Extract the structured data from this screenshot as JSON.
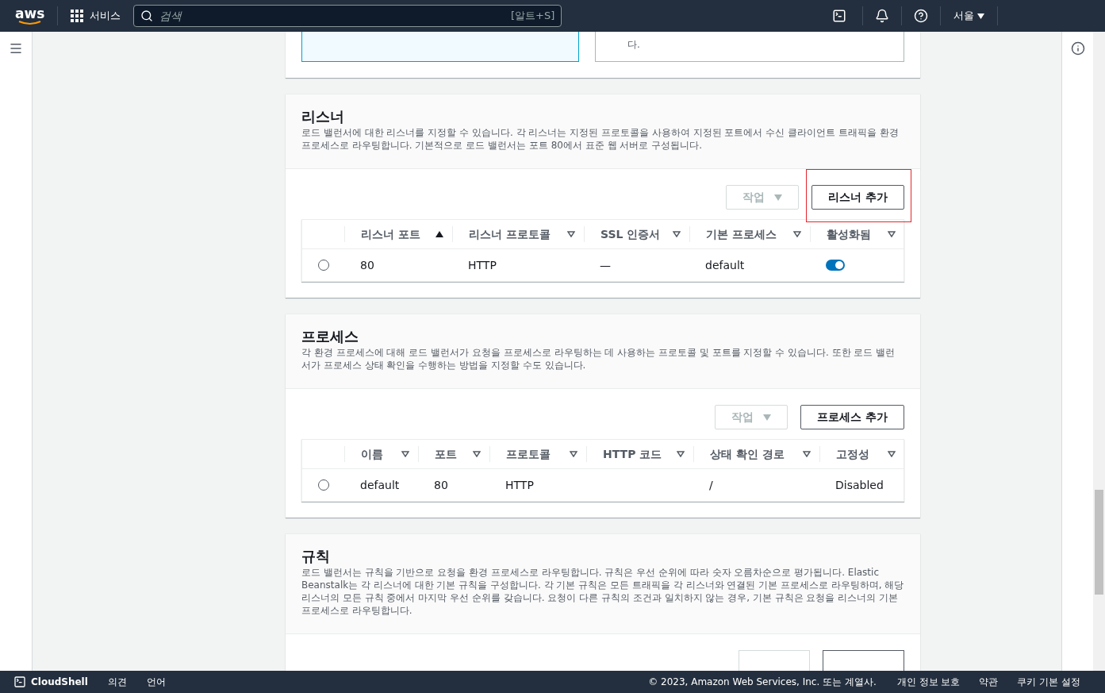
{
  "header": {
    "logo": "aws",
    "services": "서비스",
    "search": {
      "placeholder": "검색",
      "shortcut": "[알트+S]"
    },
    "region": "서울"
  },
  "top_card": {
    "right_text": "다."
  },
  "sections": [
    {
      "kind": "table",
      "title": "리스너",
      "description": "로드 밸런서에 대한 리스너를 지정할 수 있습니다. 각 리스너는 지정된 프로토콜을 사용하여 지정된 포트에서 수신 클라이언트 트래픽을 환경 프로세스로 라우팅합니다. 기본적으로 로드 밸런서는 포트 80에서 표준 웹 서버로 구성됩니다.",
      "highlight_add": true,
      "actions": [
        {
          "label": "작업",
          "disabled": true
        },
        {
          "label": "리스너 추가",
          "disabled": false
        }
      ],
      "columns": [
        {
          "label": "리스너 포트",
          "sorted": true
        },
        {
          "label": "리스너 프로토콜",
          "sorted": false
        },
        {
          "label": "SSL 인증서",
          "sorted": false
        },
        {
          "label": "기본 프로세스",
          "sorted": false
        },
        {
          "label": "활성화됨",
          "sorted": false
        }
      ],
      "rows": [
        {
          "selected": false,
          "cells": [
            {
              "kind": "text",
              "text": "80"
            },
            {
              "kind": "text",
              "text": "HTTP"
            },
            {
              "kind": "text",
              "text": "—"
            },
            {
              "kind": "text",
              "text": "default"
            },
            {
              "kind": "toggle",
              "on": true
            }
          ]
        }
      ]
    },
    {
      "kind": "table",
      "title": "프로세스",
      "description": "각 환경 프로세스에 대해 로드 밸런서가 요청을 프로세스로 라우팅하는 데 사용하는 프로토콜 및 포트를 지정할 수 있습니다. 또한 로드 밸런서가 프로세스 상태 확인을 수행하는 방법을 지정할 수도 있습니다.",
      "highlight_add": false,
      "actions": [
        {
          "label": "작업",
          "disabled": true
        },
        {
          "label": "프로세스 추가",
          "disabled": false
        }
      ],
      "columns": [
        {
          "label": "이름",
          "sorted": false
        },
        {
          "label": "포트",
          "sorted": false
        },
        {
          "label": "프로토콜",
          "sorted": false
        },
        {
          "label": "HTTP 코드",
          "sorted": false
        },
        {
          "label": "상태 확인 경로",
          "sorted": false
        },
        {
          "label": "고정성",
          "sorted": false
        }
      ],
      "rows": [
        {
          "selected": false,
          "cells": [
            {
              "kind": "text",
              "text": "default"
            },
            {
              "kind": "text",
              "text": "80"
            },
            {
              "kind": "text",
              "text": "HTTP"
            },
            {
              "kind": "text",
              "text": ""
            },
            {
              "kind": "text",
              "text": "/"
            },
            {
              "kind": "text",
              "text": "Disabled"
            }
          ]
        }
      ]
    },
    {
      "kind": "cut",
      "title": "규칙",
      "description": "로드 밸런서는 규칙을 기반으로 요청을 환경 프로세스로 라우팅합니다. 규칙은 우선 순위에 따라 숫자 오름차순으로 평가됩니다. Elastic Beanstalk는 각 리스너에 대한 기본 규칙을 구성합니다. 각 기본 규칙은 모든 트래픽을 각 리스너와 연결된 기본 프로세스로 라우팅하며, 해당 리스너의 모든 규칙 중에서 마지막 우선 순위를 갖습니다. 요청이 다른 규칙의 조건과 일치하지 않는 경우, 기본 규칙은 요청을 리스너의 기본 프로세스로 라우팅합니다."
    }
  ],
  "footer": {
    "cloudshell": "CloudShell",
    "links_left": [
      "의견",
      "언어"
    ],
    "copyright": "© 2023, Amazon Web Services, Inc. 또는 계열사.",
    "links_right": [
      "개인 정보 보호",
      "약관",
      "쿠키 기본 설정"
    ]
  }
}
